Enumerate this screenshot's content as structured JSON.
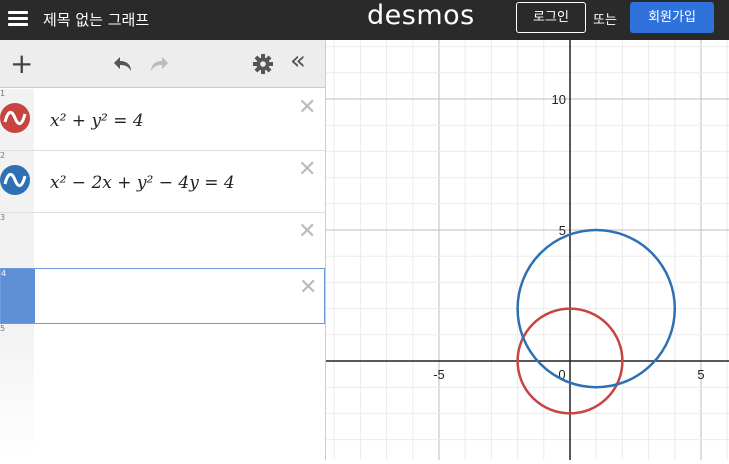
{
  "topbar": {
    "title": "제목 없는 그래프",
    "logo": "desmos",
    "login_label": "로그인",
    "or_text": "또는",
    "signup_label": "회원가입"
  },
  "toolbar": {
    "icons": [
      "plus-icon",
      "undo-icon",
      "redo-icon",
      "gear-icon",
      "collapse-icon"
    ]
  },
  "expressions": [
    {
      "num": "1",
      "latex": "x² + y² = 4",
      "color": "#c74440"
    },
    {
      "num": "2",
      "latex": "x² − 2x + y² − 4y = 4",
      "color": "#2d70b3"
    },
    {
      "num": "3",
      "latex": ""
    },
    {
      "num": "4",
      "latex": ""
    },
    {
      "num": "5",
      "latex": ""
    }
  ],
  "graph": {
    "x_tick_labels": [
      "-5",
      "0",
      "5"
    ],
    "y_tick_labels": [
      "5",
      "10"
    ],
    "x_ticks": [
      -5,
      0,
      5
    ],
    "y_ticks": [
      5,
      10
    ],
    "circles": [
      {
        "cx": 0,
        "cy": 0,
        "r": 2,
        "color": "#c74440"
      },
      {
        "cx": 1,
        "cy": 2,
        "r": 3,
        "color": "#2d70b3"
      }
    ]
  }
}
